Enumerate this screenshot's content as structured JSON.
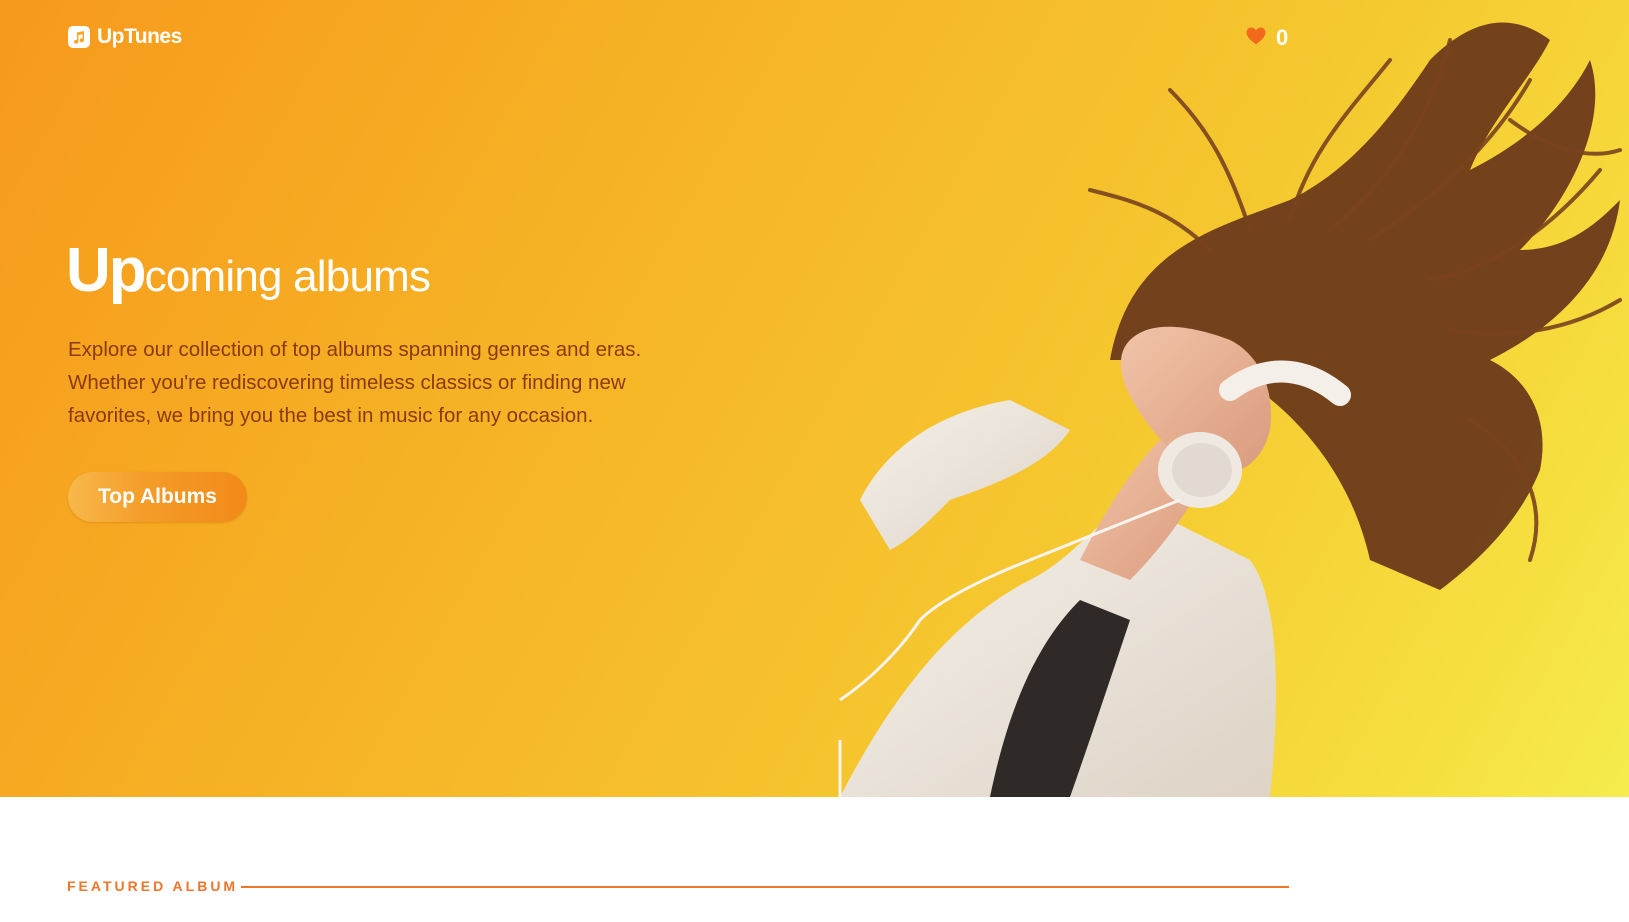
{
  "app": {
    "name": "UpTunes"
  },
  "header": {
    "logo_text": "UpTunes",
    "logo_icon": "music-note-icon",
    "favorites_icon": "heart-icon",
    "favorites_count": "0"
  },
  "hero": {
    "headline_strong": "Up",
    "headline_rest": "coming albums",
    "description": "Explore our collection of top albums spanning genres and eras. Whether you're rediscovering timeless classics or finding new favorites, we bring you the best in music for any occasion.",
    "cta_label": "Top Albums",
    "image_alt": "Woman with flowing hair wearing white headphones"
  },
  "featured": {
    "label": "FEATURED ALBUM"
  },
  "colors": {
    "gradient_start": "#f7991c",
    "gradient_end": "#f5ec4d",
    "accent": "#f0742a",
    "body_text": "#8a3a0c",
    "heart": "#f26b1d"
  }
}
